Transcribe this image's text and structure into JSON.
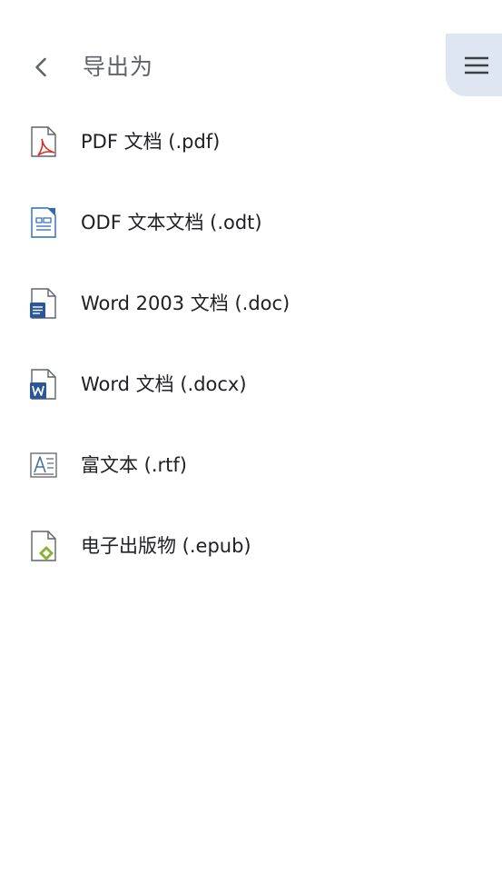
{
  "header": {
    "title": "导出为"
  },
  "export_options": [
    {
      "label": "PDF 文档 (.pdf)",
      "icon": "pdf-file-icon",
      "accent": "#d93025"
    },
    {
      "label": "ODF 文本文档 (.odt)",
      "icon": "odt-file-icon",
      "accent": "#2a6bb3"
    },
    {
      "label": "Word 2003 文档 (.doc)",
      "icon": "doc-file-icon",
      "accent": "#2b579a"
    },
    {
      "label": "Word 文档 (.docx)",
      "icon": "docx-file-icon",
      "accent": "#2b579a"
    },
    {
      "label": "富文本 (.rtf)",
      "icon": "rtf-file-icon",
      "accent": "#4a6fa5"
    },
    {
      "label": "电子出版物 (.epub)",
      "icon": "epub-file-icon",
      "accent": "#84b335"
    }
  ],
  "colors": {
    "menu_button_bg": "#dde6f1",
    "title_text": "#5f6368",
    "item_text": "#202124"
  }
}
